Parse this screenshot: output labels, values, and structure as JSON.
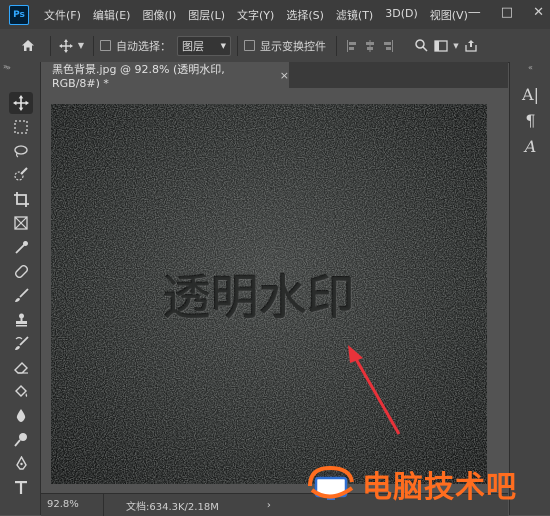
{
  "menubar": {
    "logo": "Ps",
    "items": [
      "文件(F)",
      "编辑(E)",
      "图像(I)",
      "图层(L)",
      "文字(Y)",
      "选择(S)",
      "滤镜(T)",
      "3D(D)",
      "视图(V)"
    ]
  },
  "options": {
    "auto_select_label": "自动选择：",
    "layer_option": "图层",
    "show_transform_label": "显示变换控件"
  },
  "document": {
    "tab_title": "黑色背景.jpg @ 92.8% (透明水印, RGB/8#) *",
    "watermark_text": "透明水印"
  },
  "status": {
    "zoom": "92.8%",
    "doc_info": "文档:634.3K/2.18M"
  },
  "right_panel": [
    "A|",
    "¶",
    "A"
  ],
  "brand": {
    "text": "电脑技术吧"
  },
  "colors": {
    "accent_arrow": "#e8323a",
    "brand": "#ff6d1f"
  }
}
